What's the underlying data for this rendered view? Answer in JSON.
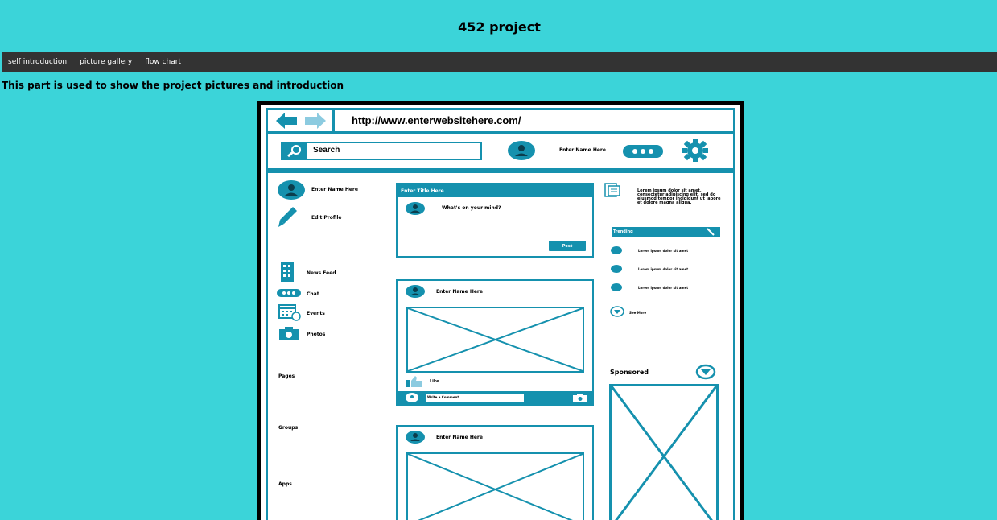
{
  "site": {
    "title": "452 project",
    "nav": [
      "self introduction",
      "picture gallery",
      "flow chart"
    ],
    "intro": "This part is used to show the project pictures and introduction"
  },
  "mockup": {
    "url": "http://www.enterwebsitehere.com/",
    "search_label": "Search",
    "header_name": "Enter Name Here",
    "sidebar": {
      "profile_name": "Enter Name Here",
      "edit_profile": "Edit Profile",
      "items": [
        "News Feed",
        "Chat",
        "Events",
        "Photos"
      ],
      "sections": [
        "Pages",
        "Groups",
        "Apps"
      ]
    },
    "composer": {
      "title": "Enter Title Here",
      "prompt": "What's on your mind?",
      "post_label": "Post"
    },
    "post1": {
      "name": "Enter Name Here",
      "like_label": "Like",
      "comment_placeholder": "Write a Comment..."
    },
    "post2": {
      "name": "Enter Name Here"
    },
    "right": {
      "lorem": "Lorem ipsum dolor sit amet, consectetur adipiscing elit, sed do eiusmod tempor incididunt ut labore et dolore magna aliqua.",
      "trending_label": "Trending",
      "trending_items": [
        "Lorem ipsum dolor sit amet",
        "Lorem ipsum dolor sit amet",
        "Lorem ipsum dolor sit amet"
      ],
      "see_more": "See More",
      "sponsored": "Sponsored"
    },
    "accent_color": "#1591ae"
  },
  "colors": {
    "page_bg": "#3bd4d9",
    "nav_bg": "#333333"
  }
}
